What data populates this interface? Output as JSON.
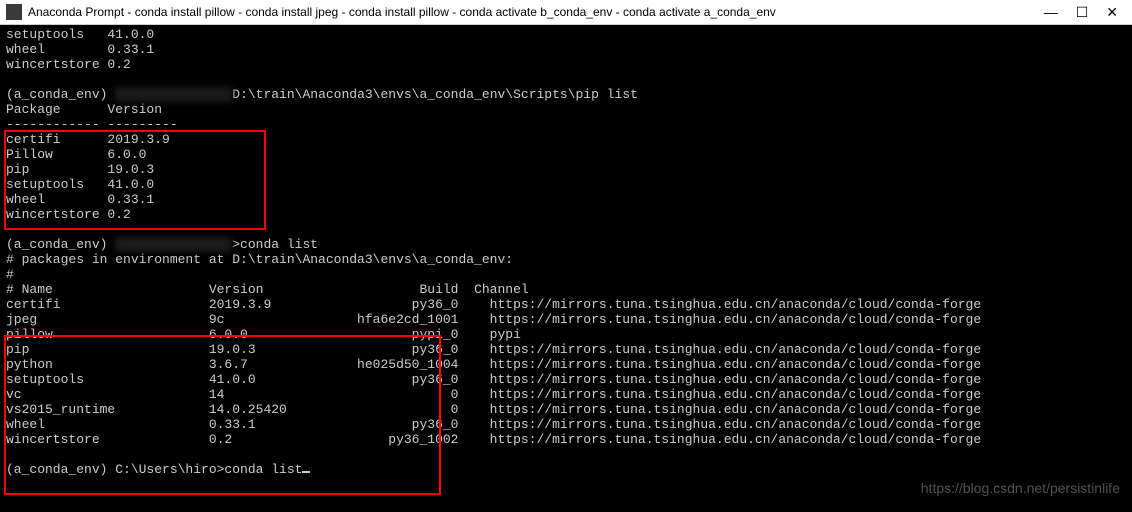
{
  "window": {
    "title": "Anaconda Prompt - conda  install pillow - conda  install jpeg - conda  install pillow - conda  activate b_conda_env - conda  activate a_conda_env",
    "minimize": "—",
    "maximize": "☐",
    "close": "✕"
  },
  "pip_top": [
    {
      "name": "setuptools",
      "version": "41.0.0"
    },
    {
      "name": "wheel",
      "version": "0.33.1"
    },
    {
      "name": "wincertstore",
      "version": "0.2"
    }
  ],
  "prompt1": {
    "env": "(a_conda_env)",
    "path": "D:\\train\\Anaconda3\\envs\\a_conda_env\\Scripts\\pip list",
    "header_pkg": "Package",
    "header_ver": "Version",
    "divider": "------------ ---------"
  },
  "pip_list": [
    {
      "name": "certifi",
      "version": "2019.3.9"
    },
    {
      "name": "Pillow",
      "version": "6.0.0"
    },
    {
      "name": "pip",
      "version": "19.0.3"
    },
    {
      "name": "setuptools",
      "version": "41.0.0"
    },
    {
      "name": "wheel",
      "version": "0.33.1"
    },
    {
      "name": "wincertstore",
      "version": "0.2"
    }
  ],
  "prompt2": {
    "env": "(a_conda_env)",
    "cmd": "conda list",
    "comment": "# packages in environment at D:\\train\\Anaconda3\\envs\\a_conda_env:",
    "hash": "#",
    "hname": "# Name",
    "hver": "Version",
    "hbuild": "Build",
    "hchan": "Channel"
  },
  "conda_list": [
    {
      "name": "certifi",
      "version": "2019.3.9",
      "build": "py36_0",
      "channel": "https://mirrors.tuna.tsinghua.edu.cn/anaconda/cloud/conda-forge"
    },
    {
      "name": "jpeg",
      "version": "9c",
      "build": "hfa6e2cd_1001",
      "channel": "https://mirrors.tuna.tsinghua.edu.cn/anaconda/cloud/conda-forge"
    },
    {
      "name": "pillow",
      "version": "6.0.0",
      "build": "pypi_0",
      "channel": "pypi"
    },
    {
      "name": "pip",
      "version": "19.0.3",
      "build": "py36_0",
      "channel": "https://mirrors.tuna.tsinghua.edu.cn/anaconda/cloud/conda-forge"
    },
    {
      "name": "python",
      "version": "3.6.7",
      "build": "he025d50_1004",
      "channel": "https://mirrors.tuna.tsinghua.edu.cn/anaconda/cloud/conda-forge"
    },
    {
      "name": "setuptools",
      "version": "41.0.0",
      "build": "py36_0",
      "channel": "https://mirrors.tuna.tsinghua.edu.cn/anaconda/cloud/conda-forge"
    },
    {
      "name": "vc",
      "version": "14",
      "build": "0",
      "channel": "https://mirrors.tuna.tsinghua.edu.cn/anaconda/cloud/conda-forge"
    },
    {
      "name": "vs2015_runtime",
      "version": "14.0.25420",
      "build": "0",
      "channel": "https://mirrors.tuna.tsinghua.edu.cn/anaconda/cloud/conda-forge"
    },
    {
      "name": "wheel",
      "version": "0.33.1",
      "build": "py36_0",
      "channel": "https://mirrors.tuna.tsinghua.edu.cn/anaconda/cloud/conda-forge"
    },
    {
      "name": "wincertstore",
      "version": "0.2",
      "build": "py36_1002",
      "channel": "https://mirrors.tuna.tsinghua.edu.cn/anaconda/cloud/conda-forge"
    }
  ],
  "prompt3": {
    "env": "(a_conda_env)",
    "path": "C:\\Users\\hiro>",
    "cmd": "conda list"
  },
  "watermark": "https://blog.csdn.net/persistinlife"
}
